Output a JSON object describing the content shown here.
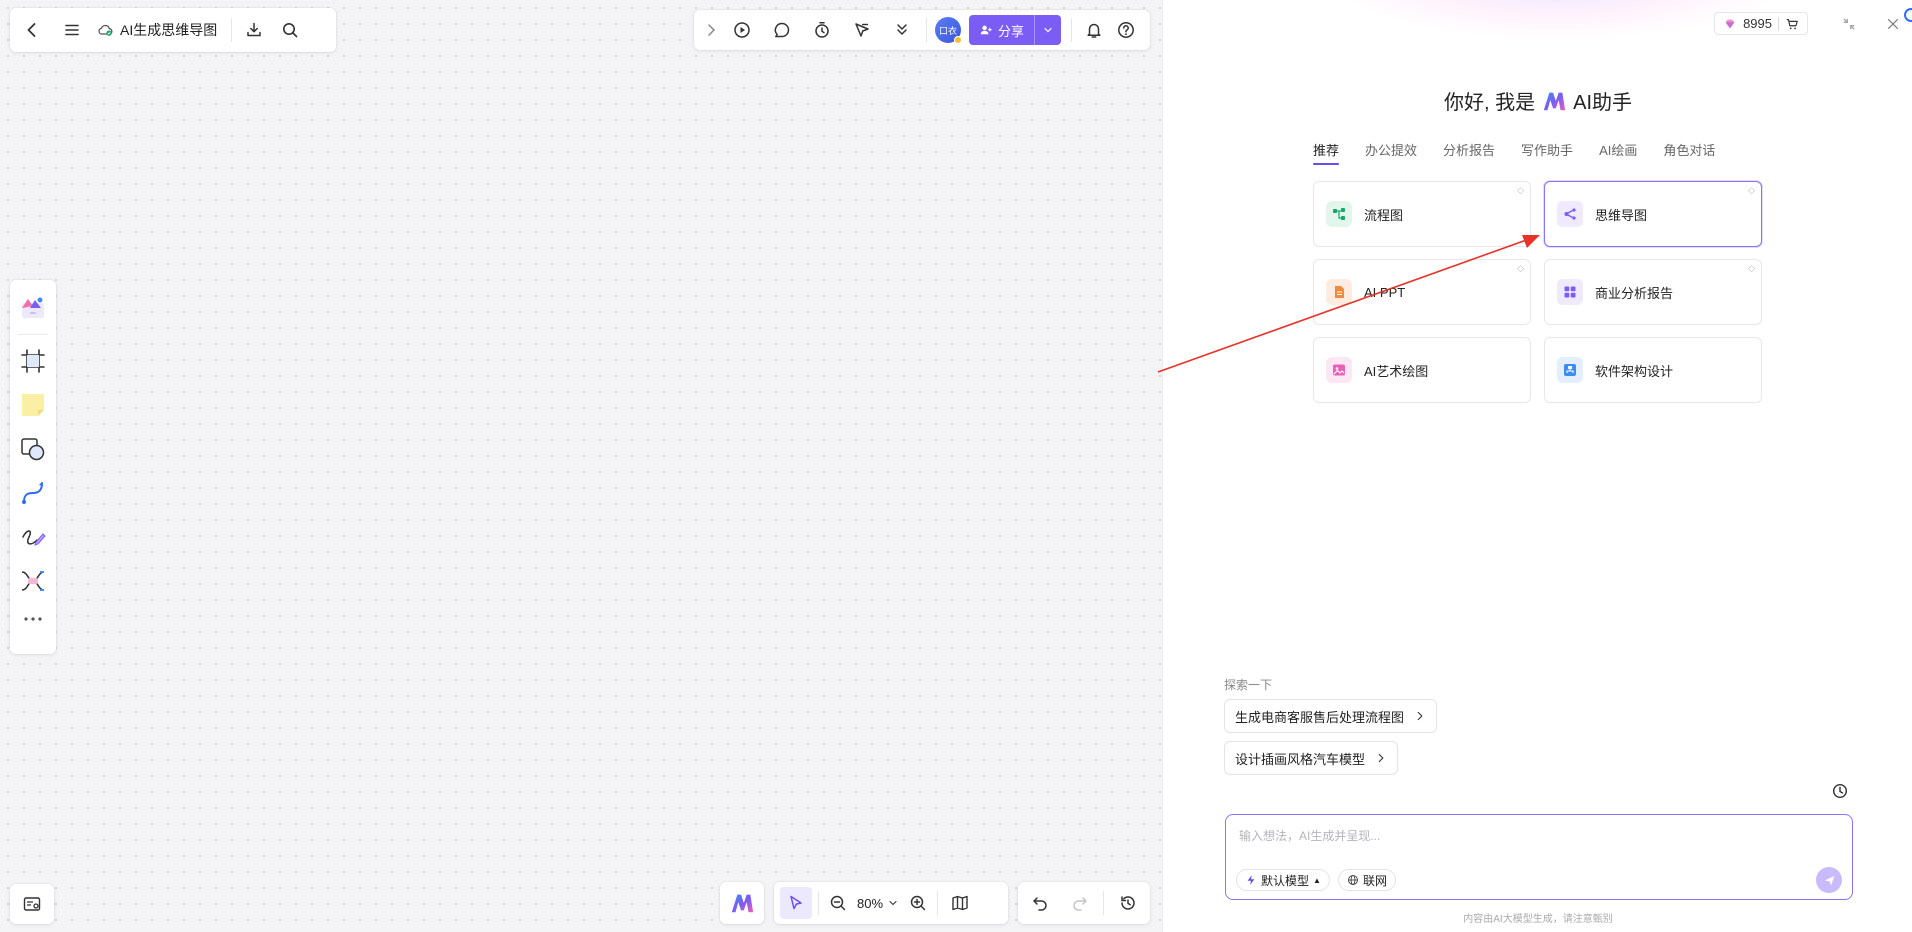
{
  "toolbar_left": {
    "title": "AI生成思维导图"
  },
  "toolbar_right": {
    "avatar_text": "口衣",
    "share_label": "分享"
  },
  "bottom_bar": {
    "zoom": "80%"
  },
  "ai_panel": {
    "credits": "8995",
    "greeting_prefix": "你好, 我是",
    "greeting_suffix": "AI助手",
    "tabs": [
      "推荐",
      "办公提效",
      "分析报告",
      "写作助手",
      "AI绘画",
      "角色对话"
    ],
    "cards": [
      {
        "label": "流程图",
        "icon": "flowchart-icon",
        "color": "#1aa66a"
      },
      {
        "label": "思维导图",
        "icon": "mindmap-icon",
        "color": "#7b5cf5"
      },
      {
        "label": "AI PPT",
        "icon": "ppt-icon",
        "color": "#f08a3c"
      },
      {
        "label": "商业分析报告",
        "icon": "grid-icon",
        "color": "#7b5cf5"
      },
      {
        "label": "AI艺术绘图",
        "icon": "image-icon",
        "color": "#e860b8"
      },
      {
        "label": "软件架构设计",
        "icon": "architecture-icon",
        "color": "#3b8ef0"
      }
    ],
    "explore_label": "探索一下",
    "suggestions": [
      "生成电商客服售后处理流程图",
      "设计插画风格汽车模型"
    ],
    "input_placeholder": "输入想法，AI生成并呈现...",
    "model_label": "默认模型",
    "web_label": "联网",
    "disclaimer": "内容由AI大模型生成，请注意甄别"
  },
  "colors": {
    "accent": "#7b5cf5",
    "arrow": "#e8332a"
  }
}
